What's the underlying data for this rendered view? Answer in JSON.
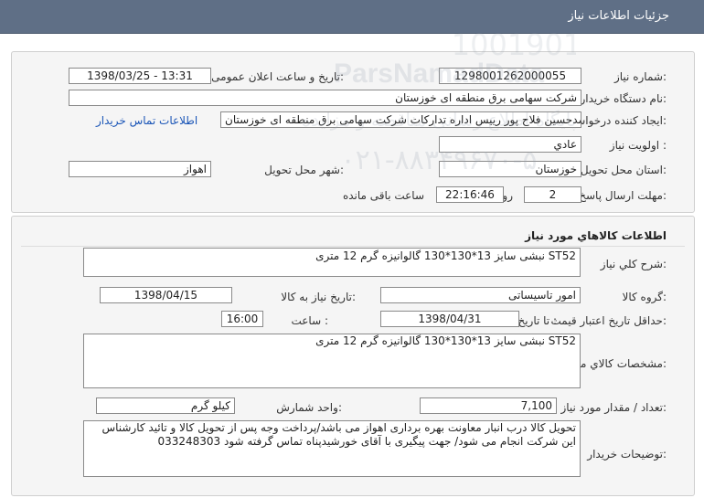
{
  "header": {
    "title": "جزئیات اطلاعات نیاز"
  },
  "need_info": {
    "need_number_label": "شماره نیاز:",
    "need_number": "1298001262000055",
    "announce_label": "تاریخ و ساعت اعلان عمومی:",
    "announce_value": "1398/03/25 - 13:31",
    "buyer_org_label": "نام دستگاه خریدار:",
    "buyer_org": "شرکت سهامی برق منطقه ای خوزستان",
    "requester_label": "ایجاد کننده درخواست:",
    "requester": "محمدحسین فلاح پور رییس اداره تدارکات شرکت سهامی برق منطقه ای خوزستان",
    "contact_link": "اطلاعات تماس خریدار",
    "priority_label": "اولویت نیاز :",
    "priority": "عادي",
    "province_label": "استان محل تحویل:",
    "province": "خوزستان",
    "city_label": "شهر محل تحویل:",
    "city": "اهواز",
    "deadline_label": "مهلت ارسال پاسخ:",
    "days_value": "2",
    "days_label": "روز و",
    "time_left": "22:16:46",
    "remaining_label": "ساعت باقی مانده"
  },
  "goods_info": {
    "section_title": "اطلاعات کالاهاي مورد نياز",
    "general_desc_label": "شرح کلي نياز:",
    "general_desc": "نبشی سایز 13*130*130 گالوانیزه گرم 12 متری ST52",
    "goods_group_label": "گروه کالا:",
    "goods_group": "امور تاسیساتی",
    "need_date_label": "تاریخ نیاز به کالا:",
    "need_date": "1398/04/15",
    "price_validity_label": "حداقل تاريخ اعتبار قيمت:",
    "to_date_label": "تا تاریخ :",
    "price_date": "1398/04/31",
    "hour_label": "ساعت :",
    "price_hour": "16:00",
    "specs_label": "مشخصات کالاي مورد نياز:",
    "specs": "نبشی سایز 13*130*130 گالوانیزه گرم 12 متری ST52",
    "qty_label": "تعداد / مقدار مورد نیاز:",
    "qty": "7,100",
    "unit_label": "واحد شمارش:",
    "unit": "کیلو گرم",
    "buyer_notes_label": "توضیحات خریدار:",
    "buyer_notes": "تحویل کالا درب انبار معاونت بهره برداری اهواز می باشد/پرداخت وجه پس از تحویل کالا و تائید کارشناس این شرکت انجام می شود/ جهت پیگیری با آقای خورشیدپناه تماس گرفته شود 033248303"
  },
  "watermark": {
    "brand": "ParsNamadData",
    "line1": "پایگاه اطلاع رسانی مناقصه و مزایده",
    "line2": "۰۲۱-۸۸۳۴۹۶۷۰-۵",
    "side_digits": "1001901"
  }
}
